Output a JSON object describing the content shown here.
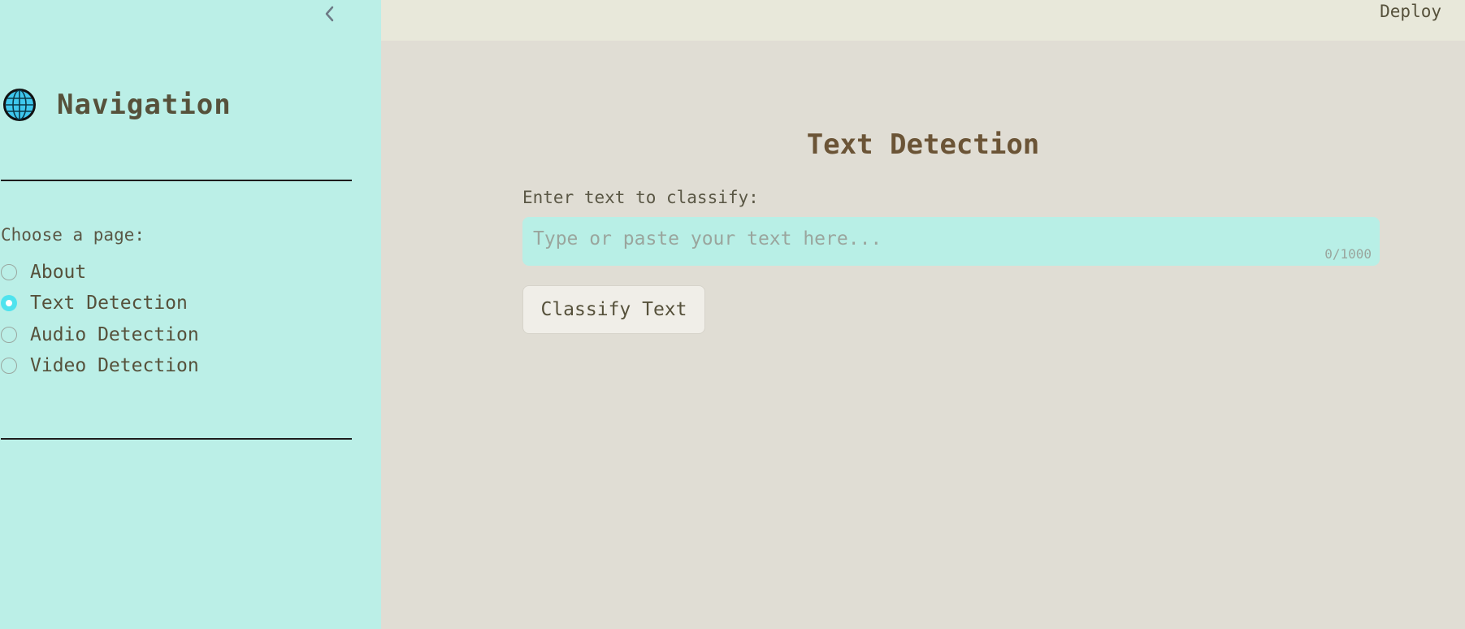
{
  "header": {
    "deploy_label": "Deploy"
  },
  "sidebar": {
    "collapse_icon": "chevron-left-icon",
    "nav_icon": "globe-icon",
    "title": "Navigation",
    "choose_label": "Choose a page:",
    "pages": [
      {
        "label": "About",
        "selected": false
      },
      {
        "label": "Text Detection",
        "selected": true
      },
      {
        "label": "Audio Detection",
        "selected": false
      },
      {
        "label": "Video Detection",
        "selected": false
      }
    ],
    "accent_color": "#4fe3ee"
  },
  "main": {
    "title": "Text Detection",
    "input_label": "Enter text to classify:",
    "input_placeholder": "Type or paste your text here...",
    "input_value": "",
    "char_count": "0/1000",
    "classify_label": "Classify Text"
  },
  "colors": {
    "sidebar_bg": "#bbefe7",
    "main_bg": "#e0ddd4",
    "header_bg": "#e8e8da",
    "title_color": "#6b5436",
    "text_color": "#56513b"
  }
}
